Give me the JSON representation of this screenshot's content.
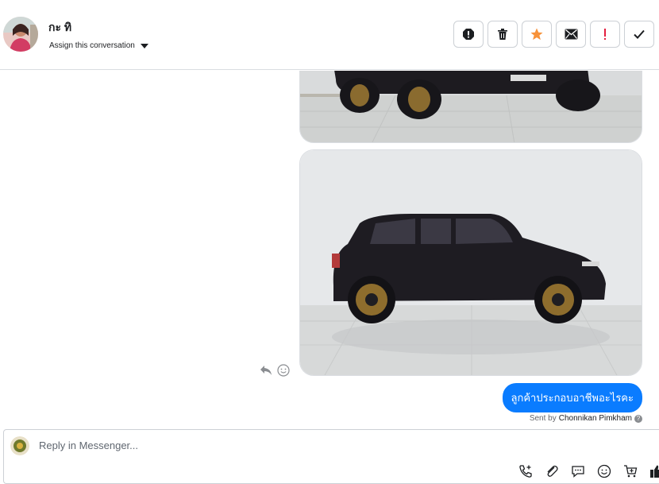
{
  "header": {
    "contact_name": "กะ ทิ",
    "assign_label": "Assign this conversation",
    "actions": [
      {
        "icon": "spam-icon"
      },
      {
        "icon": "trash-icon"
      },
      {
        "icon": "star-icon",
        "color": "#f7923a"
      },
      {
        "icon": "mark-unread-icon"
      },
      {
        "icon": "follow-up-icon",
        "color": "#e41e3f"
      },
      {
        "icon": "done-check-icon"
      }
    ]
  },
  "thread": {
    "messages": [
      {
        "type": "image",
        "description_icon": "car-photo"
      },
      {
        "type": "image",
        "description_icon": "car-photo"
      },
      {
        "type": "text",
        "text": "ลูกค้าประกอบอาชีพอะไรคะ"
      }
    ],
    "sent_by_prefix": "Sent by",
    "sent_by_name": "Chonnikan Pimkham",
    "message_tools": [
      "reply-icon",
      "react-icon"
    ]
  },
  "composer": {
    "placeholder": "Reply in Messenger...",
    "toolbar": [
      "phone-add-icon",
      "attachment-icon",
      "saved-reply-icon",
      "emoji-icon",
      "cart-icon",
      "like-icon"
    ]
  },
  "colors": {
    "bubble": "#0a7cff",
    "star": "#f7923a",
    "alert": "#e41e3f"
  }
}
